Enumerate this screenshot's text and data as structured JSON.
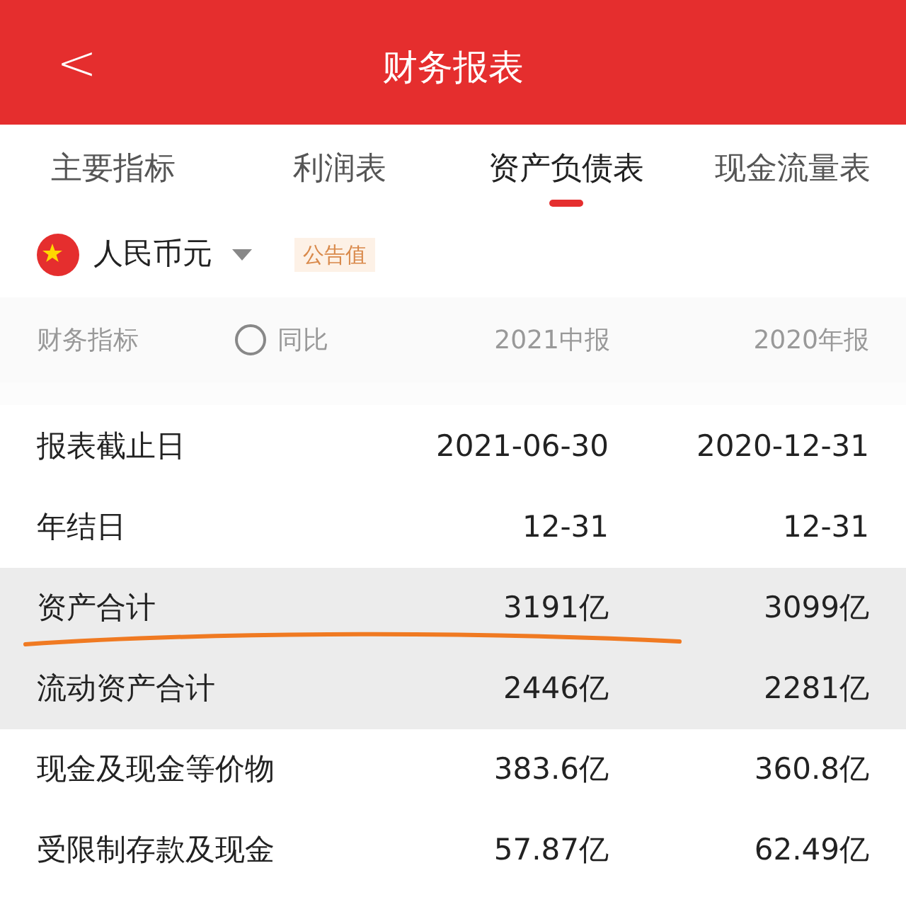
{
  "header": {
    "back": "<",
    "title": "财务报表"
  },
  "tabs": [
    {
      "label": "主要指标",
      "selected": false
    },
    {
      "label": "利润表",
      "selected": false
    },
    {
      "label": "资产负债表",
      "selected": true
    },
    {
      "label": "现金流量表",
      "selected": false
    }
  ],
  "currency": {
    "label": "人民币元",
    "badge": "公告值"
  },
  "yoy": {
    "label": "同比",
    "checked": false
  },
  "table": {
    "columns": [
      "财务指标",
      "2021中报",
      "2020年报"
    ],
    "rows": [
      {
        "cells": [
          "报表截止日",
          "2021-06-30",
          "2020-12-31"
        ],
        "highlighted": false
      },
      {
        "cells": [
          "年结日",
          "12-31",
          "12-31"
        ],
        "highlighted": false
      },
      {
        "cells": [
          "资产合计",
          "3191亿",
          "3099亿"
        ],
        "highlighted": true,
        "underlined": true
      },
      {
        "cells": [
          "流动资产合计",
          "2446亿",
          "2281亿"
        ],
        "highlighted": true
      },
      {
        "cells": [
          "现金及现金等价物",
          "383.6亿",
          "360.8亿"
        ],
        "highlighted": false
      },
      {
        "cells": [
          "受限制存款及现金",
          "57.87亿",
          "62.49亿"
        ],
        "highlighted": false
      }
    ]
  }
}
